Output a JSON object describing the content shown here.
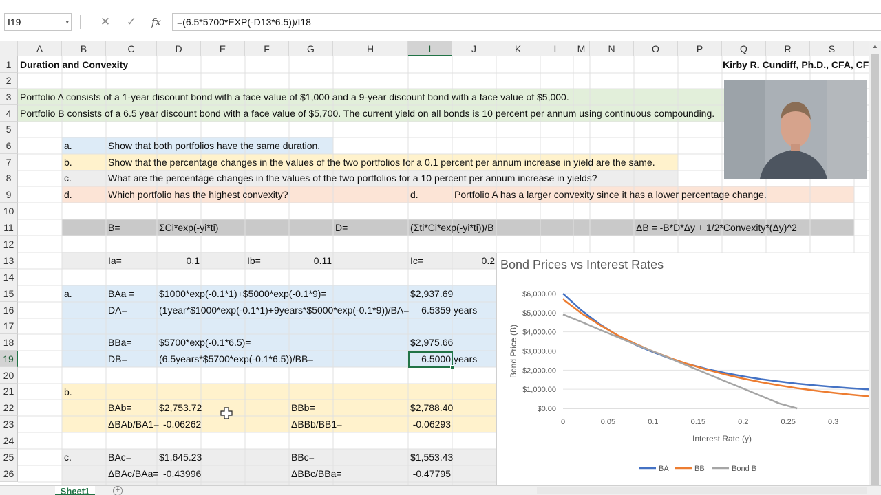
{
  "formula_bar": {
    "name_box": "I19",
    "cancel_icon": "✕",
    "enter_icon": "✓",
    "fx_label": "fx",
    "formula": "=(6.5*5700*EXP(-D13*6.5))/I18"
  },
  "columns": [
    "A",
    "B",
    "C",
    "D",
    "E",
    "F",
    "G",
    "H",
    "I",
    "J",
    "K",
    "L",
    "M",
    "N",
    "O",
    "P",
    "Q",
    "R",
    "S"
  ],
  "rows": [
    "1",
    "2",
    "3",
    "4",
    "5",
    "6",
    "7",
    "8",
    "9",
    "10",
    "11",
    "12",
    "13",
    "14",
    "15",
    "16",
    "17",
    "18",
    "19",
    "20",
    "21",
    "22",
    "23",
    "24",
    "25",
    "26"
  ],
  "selected": {
    "column": "I",
    "row": "19"
  },
  "sheet": {
    "r1_title": "Duration and Convexity",
    "r1_author": "Kirby R. Cundiff, Ph.D., CFA, CFP®",
    "r3": "Portfolio A consists of a 1-year discount bond with a face value of $1,000 and a 9-year discount bond with a face value of $5,000.",
    "r4": "Portfolio B consists of a 6.5 year discount bond with a face value of $5,700. The current yield on all bonds is 10 percent per annum using continuous compounding.",
    "r6_label": "a.",
    "r6_text": "Show that both portfolios have the same duration.",
    "r7_label": "b.",
    "r7_text": "Show that the percentage changes in the values of the two portfolios for a 0.1 percent per annum increase in yield are the same.",
    "r8_label": "c.",
    "r8_text": "What are the percentage changes in the values of the two portfolios for a 10 percent per annum increase in yields?",
    "r9_label": "d.",
    "r9_text": "Which portfolio has the highest convexity?",
    "r9_ans_label": "d.",
    "r9_ans_text": "Portfolio A has a larger convexity since it has a lower percentage change.",
    "r11_b": "B=",
    "r11_b_formula": "ΣCi*exp(-yi*ti)",
    "r11_d": "D=",
    "r11_d_formula": "(Σti*Ci*exp(-yi*ti))/B",
    "r11_delta": "ΔB = -B*D*Δy + 1/2*Convexity*(Δy)^2",
    "r13_ia": "Ia=",
    "r13_ia_val": "0.1",
    "r13_ib": "Ib=",
    "r13_ib_val": "0.11",
    "r13_ic": "Ic=",
    "r13_ic_val": "0.2",
    "r15_label": "a.",
    "r15_baa": "BAa =",
    "r15_formula": "$1000*exp(-0.1*1)+$5000*exp(-0.1*9)=",
    "r15_val": "$2,937.69",
    "r16_da": "DA=",
    "r16_formula": "(1year*$1000*exp(-0.1*1)+9years*$5000*exp(-0.1*9))/BA=",
    "r16_val": "6.5359",
    "r16_unit": "years",
    "r18_bba": "BBa=",
    "r18_formula": "$5700*exp(-0.1*6.5)=",
    "r18_val": "$2,975.66",
    "r19_db": "DB=",
    "r19_formula": "(6.5years*$5700*exp(-0.1*6.5))/BB=",
    "r19_val": "6.5000",
    "r19_unit": "years",
    "r21_label": "b.",
    "r22_bab": "BAb=",
    "r22_bab_val": "$2,753.72",
    "r22_bbb": "BBb=",
    "r22_bbb_val": "$2,788.40",
    "r23_dbab": "ΔBAb/BA1=",
    "r23_dbab_val": "-0.06262",
    "r23_dbbb": "ΔBBb/BB1=",
    "r23_dbbb_val": "-0.06293",
    "r25_label": "c.",
    "r25_bac": "BAc=",
    "r25_bac_val": "$1,645.23",
    "r25_bbc": "BBc=",
    "r25_bbc_val": "$1,553.43",
    "r26_dbac": "ΔBAc/BAa=",
    "r26_dbac_val": "-0.43996",
    "r26_dbbc": "ΔBBc/BBa=",
    "r26_dbbc_val": "-0.47795"
  },
  "sheet_tab": "Sheet1",
  "add_sheet_icon": "+",
  "colors": {
    "green_fill": "#e2efda",
    "blue_fill": "#ddebf7",
    "yellow_fill": "#fff2cc",
    "gray_light": "#ededed",
    "orange_fill": "#fce4d6",
    "gray_dark": "#c9c9c9",
    "excel_green": "#217346",
    "series_ba": "#4472c4",
    "series_bb": "#ed7d31",
    "series_bondb": "#a5a5a5"
  },
  "chart_data": {
    "type": "line",
    "title": "Bond Prices vs Interest Rates",
    "xlabel": "Interest Rate (y)",
    "ylabel": "Bond Price (B)",
    "xlim": [
      0,
      0.34
    ],
    "ylim": [
      0,
      6000
    ],
    "x_ticks": [
      "0",
      "0.05",
      "0.1",
      "0.15",
      "0.2",
      "0.25",
      "0.3"
    ],
    "y_ticks": [
      "$0.00",
      "$1,000.00",
      "$2,000.00",
      "$3,000.00",
      "$4,000.00",
      "$5,000.00",
      "$6,000.00"
    ],
    "legend_position": "bottom",
    "x": [
      0,
      0.02,
      0.04,
      0.06,
      0.08,
      0.1,
      0.12,
      0.14,
      0.16,
      0.18,
      0.2,
      0.22,
      0.24,
      0.26,
      0.28,
      0.3,
      0.32,
      0.34
    ],
    "series": [
      {
        "name": "BA",
        "values": [
          6000,
          5138,
          4424,
          3829,
          3335,
          2938,
          2589,
          2300,
          2056,
          1850,
          1677,
          1528,
          1403,
          1295,
          1203,
          1123,
          1054,
          993
        ]
      },
      {
        "name": "BB",
        "values": [
          5700,
          4982,
          4383,
          3840,
          3383,
          2976,
          2616,
          2299,
          2020,
          1775,
          1559,
          1370,
          1204,
          1058,
          929,
          817,
          717,
          630
        ]
      },
      {
        "name": "Bond B",
        "values": [
          4910,
          4530,
          4130,
          3740,
          3350,
          2976,
          2590,
          2200,
          1810,
          1420,
          1040,
          650,
          260,
          0,
          null,
          null,
          null,
          null
        ]
      }
    ]
  }
}
